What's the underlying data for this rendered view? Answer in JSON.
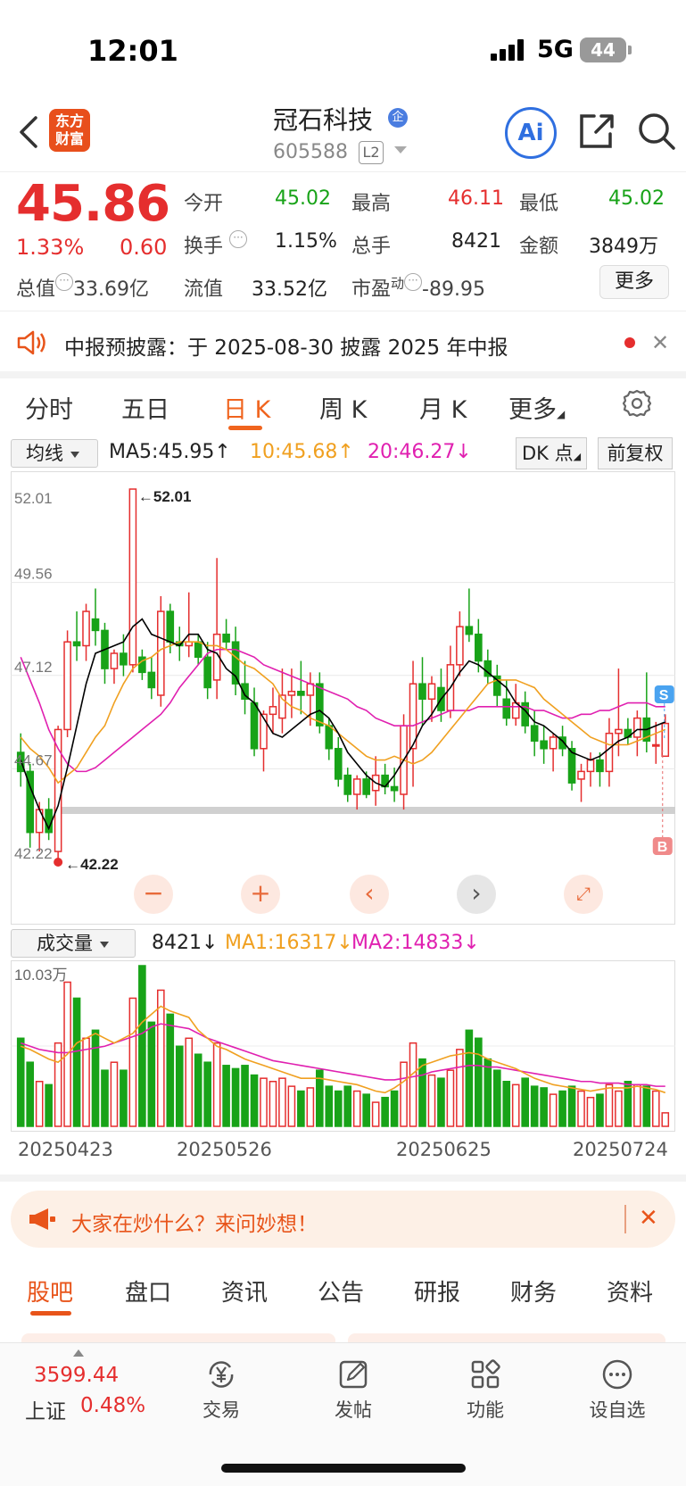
{
  "status": {
    "time": "12:01",
    "network": "5G",
    "battery": "44"
  },
  "header": {
    "logo_line1": "东方",
    "logo_line2": "财富",
    "stock_name": "冠石科技",
    "ent_badge": "企",
    "stock_code": "605588",
    "level": "L2",
    "ai_label": "Ai"
  },
  "quote": {
    "price": "45.86",
    "change_pct": "1.33%",
    "change": "0.60",
    "open_label": "今开",
    "open": "45.02",
    "high_label": "最高",
    "high": "46.11",
    "low_label": "最低",
    "low": "45.02",
    "turnover_label": "换手",
    "turnover": "1.15%",
    "volume_label": "总手",
    "volume": "8421",
    "amount_label": "金额",
    "amount": "3849万",
    "mcap_label": "总值",
    "mcap": "33.69亿",
    "float_label": "流值",
    "float": "33.52亿",
    "pe_label": "市盈",
    "pe_sup": "动",
    "pe": "-89.95",
    "more": "更多"
  },
  "notice": {
    "text": "中报预披露：于 2025-08-30 披露 2025 年中报"
  },
  "chart_tabs": [
    "分时",
    "五日",
    "日 K",
    "周 K",
    "月 K",
    "更多"
  ],
  "active_chart_tab": "日 K",
  "indicators": {
    "select": "均线",
    "ma5": "MA5:45.95↑",
    "ma10": "10:45.68↑",
    "ma20": "20:46.27↓",
    "dk": "DK 点",
    "fq": "前复权"
  },
  "volume_indicators": {
    "select": "成交量",
    "value": "8421↓",
    "ma1": "MA1:16317↓",
    "ma2": "MA2:14833↓"
  },
  "promo": {
    "text": "大家在炒什么？来问妙想！"
  },
  "bottom_tabs": [
    "股吧",
    "盘口",
    "资讯",
    "公告",
    "研报",
    "财务",
    "资料"
  ],
  "index": {
    "value": "3599.44",
    "name": "上证",
    "pct": "0.48%"
  },
  "nav": [
    "交易",
    "发帖",
    "功能",
    "设自选"
  ],
  "colors": {
    "up": "#e52e2e",
    "down": "#18a318",
    "ma5": "#000000",
    "ma10": "#f0a020",
    "ma20": "#e020b0",
    "accent": "#f0641e"
  },
  "chart_data": {
    "type": "candlestick",
    "y_ticks": [
      "52.01",
      "49.56",
      "47.12",
      "44.67",
      "42.22"
    ],
    "ylim": [
      42.22,
      52.01
    ],
    "max_label": "52.01",
    "min_label": "42.22",
    "x_ticks": [
      "20250423",
      "20250526",
      "20250625",
      "20250724"
    ],
    "volume_top_label": "10.03万",
    "volume_max": 100300,
    "markers": [
      "S",
      "B"
    ],
    "candles": [
      [
        45.1,
        45.6,
        44.2,
        44.6,
        55000
      ],
      [
        44.6,
        44.8,
        42.6,
        43.0,
        40000
      ],
      [
        43.0,
        43.8,
        42.5,
        43.6,
        28000
      ],
      [
        43.6,
        43.9,
        42.8,
        43.0,
        26000
      ],
      [
        42.5,
        45.8,
        42.22,
        45.7,
        52000
      ],
      [
        45.7,
        48.3,
        45.5,
        48.0,
        90000
      ],
      [
        48.0,
        48.8,
        47.5,
        47.9,
        80000
      ],
      [
        47.9,
        49.0,
        47.5,
        48.8,
        55000
      ],
      [
        48.6,
        49.4,
        47.9,
        48.3,
        60000
      ],
      [
        48.3,
        48.5,
        46.9,
        47.3,
        35000
      ],
      [
        47.3,
        47.8,
        46.9,
        47.7,
        40000
      ],
      [
        47.7,
        48.2,
        47.1,
        47.4,
        35000
      ],
      [
        47.4,
        52.01,
        47.2,
        52.01,
        80000
      ],
      [
        47.6,
        47.8,
        47.0,
        47.2,
        100300
      ],
      [
        47.2,
        47.6,
        46.5,
        46.8,
        65000
      ],
      [
        46.6,
        49.2,
        46.3,
        48.8,
        85000
      ],
      [
        48.8,
        49.0,
        47.7,
        48.0,
        70000
      ],
      [
        48.0,
        48.4,
        47.5,
        47.9,
        50000
      ],
      [
        47.9,
        49.3,
        47.6,
        48.0,
        55000
      ],
      [
        48.0,
        48.2,
        47.4,
        47.6,
        45000
      ],
      [
        47.6,
        48.0,
        46.5,
        46.8,
        40000
      ],
      [
        47.0,
        50.2,
        46.5,
        48.2,
        52000
      ],
      [
        48.2,
        48.6,
        47.8,
        48.0,
        38000
      ],
      [
        48.0,
        48.4,
        46.6,
        46.9,
        36000
      ],
      [
        46.9,
        47.5,
        46.1,
        46.5,
        38000
      ],
      [
        46.4,
        46.8,
        45.0,
        45.2,
        32000
      ],
      [
        45.2,
        46.2,
        44.6,
        46.1,
        30000
      ],
      [
        46.1,
        46.8,
        45.6,
        46.3,
        28000
      ],
      [
        46.0,
        47.3,
        45.6,
        46.6,
        30000
      ],
      [
        46.6,
        47.3,
        46.0,
        46.7,
        25000
      ],
      [
        46.7,
        47.5,
        46.1,
        46.6,
        22000
      ],
      [
        46.6,
        47.2,
        45.8,
        46.9,
        24000
      ],
      [
        46.9,
        47.2,
        45.6,
        45.8,
        35000
      ],
      [
        45.8,
        46.0,
        44.9,
        45.2,
        25000
      ],
      [
        45.2,
        45.5,
        44.2,
        44.4,
        22000
      ],
      [
        44.5,
        44.7,
        43.8,
        44.0,
        25000
      ],
      [
        44.0,
        44.5,
        43.6,
        44.4,
        22000
      ],
      [
        44.4,
        44.6,
        43.9,
        44.0,
        20000
      ],
      [
        44.1,
        45.0,
        43.7,
        44.5,
        15000
      ],
      [
        44.5,
        44.8,
        44.0,
        44.2,
        18000
      ],
      [
        44.2,
        44.7,
        43.8,
        44.1,
        22000
      ],
      [
        44.0,
        46.1,
        43.6,
        45.8,
        40000
      ],
      [
        45.2,
        47.5,
        44.2,
        46.9,
        52000
      ],
      [
        46.9,
        47.6,
        45.8,
        46.5,
        42000
      ],
      [
        46.5,
        47.1,
        45.9,
        46.9,
        32000
      ],
      [
        46.8,
        47.3,
        45.9,
        46.2,
        30000
      ],
      [
        46.2,
        47.9,
        46.0,
        47.4,
        35000
      ],
      [
        47.4,
        48.8,
        47.1,
        48.4,
        48000
      ],
      [
        48.4,
        49.4,
        48.0,
        48.2,
        60000
      ],
      [
        48.2,
        48.6,
        47.2,
        47.5,
        55000
      ],
      [
        47.5,
        47.8,
        46.9,
        47.1,
        42000
      ],
      [
        47.1,
        47.4,
        46.3,
        46.6,
        35000
      ],
      [
        46.5,
        47.0,
        45.8,
        46.0,
        28000
      ],
      [
        46.0,
        46.9,
        45.8,
        46.4,
        26000
      ],
      [
        46.4,
        46.7,
        45.6,
        45.8,
        30000
      ],
      [
        45.8,
        46.2,
        45.0,
        45.4,
        25000
      ],
      [
        45.4,
        45.8,
        44.8,
        45.2,
        24000
      ],
      [
        45.2,
        45.6,
        44.6,
        45.5,
        20000
      ],
      [
        45.5,
        45.8,
        45.0,
        45.2,
        22000
      ],
      [
        45.2,
        45.4,
        44.1,
        44.3,
        25000
      ],
      [
        44.4,
        44.8,
        43.8,
        44.6,
        22000
      ],
      [
        44.6,
        45.1,
        44.2,
        44.9,
        18000
      ],
      [
        44.9,
        45.1,
        44.2,
        44.6,
        20000
      ],
      [
        44.6,
        46.0,
        44.2,
        45.6,
        26000
      ],
      [
        45.6,
        47.3,
        45.0,
        45.7,
        22000
      ],
      [
        45.7,
        46.0,
        45.3,
        45.5,
        28000
      ],
      [
        45.5,
        46.2,
        45.0,
        46.0,
        26000
      ],
      [
        46.0,
        47.2,
        45.1,
        45.4,
        25000
      ],
      [
        45.3,
        45.9,
        44.8,
        45.3,
        22000
      ],
      [
        45.0,
        46.1,
        45.0,
        45.86,
        8421
      ]
    ],
    "ma5": [
      44.9,
      44.2,
      43.6,
      43.1,
      43.7,
      44.7,
      45.8,
      46.9,
      47.7,
      47.8,
      47.9,
      48.0,
      48.4,
      48.6,
      48.2,
      48.1,
      48.0,
      47.9,
      48.2,
      48.2,
      47.8,
      47.7,
      47.3,
      47.1,
      46.6,
      46.4,
      46.0,
      45.6,
      45.5,
      45.7,
      45.9,
      46.1,
      46.2,
      46.0,
      45.6,
      45.1,
      44.8,
      44.5,
      44.3,
      44.2,
      44.5,
      44.9,
      45.3,
      45.8,
      46.1,
      46.5,
      46.8,
      47.2,
      47.5,
      47.4,
      47.2,
      47.0,
      46.8,
      46.4,
      46.2,
      45.9,
      45.8,
      45.6,
      45.4,
      45.1,
      45.0,
      44.9,
      45.0,
      45.2,
      45.4,
      45.5,
      45.7,
      45.7,
      45.8,
      45.9
    ],
    "ma10": [
      45.5,
      45.2,
      45.0,
      44.7,
      44.3,
      44.5,
      44.7,
      45.1,
      45.5,
      45.8,
      46.4,
      46.9,
      47.3,
      47.5,
      47.6,
      47.8,
      47.9,
      48.0,
      48.0,
      48.0,
      47.9,
      47.9,
      47.8,
      47.6,
      47.4,
      47.3,
      47.1,
      46.9,
      46.5,
      46.3,
      46.2,
      46.0,
      45.9,
      45.8,
      45.6,
      45.4,
      45.2,
      45.0,
      44.9,
      44.9,
      45.0,
      44.9,
      44.8,
      44.9,
      45.1,
      45.4,
      45.7,
      46.0,
      46.3,
      46.6,
      46.9,
      47.0,
      47.0,
      47.0,
      46.9,
      46.8,
      46.5,
      46.3,
      46.1,
      45.9,
      45.7,
      45.5,
      45.4,
      45.3,
      45.3,
      45.3,
      45.4,
      45.5,
      45.6,
      45.7
    ],
    "ma20": [
      47.6,
      47.0,
      46.4,
      45.7,
      45.2,
      44.8,
      44.6,
      44.6,
      44.7,
      44.9,
      45.1,
      45.3,
      45.5,
      45.7,
      45.9,
      46.1,
      46.4,
      46.8,
      47.1,
      47.4,
      47.7,
      47.8,
      47.8,
      47.8,
      47.7,
      47.6,
      47.4,
      47.3,
      47.2,
      47.1,
      47.0,
      46.9,
      46.8,
      46.7,
      46.6,
      46.5,
      46.3,
      46.2,
      46.0,
      45.9,
      45.8,
      45.8,
      45.8,
      45.9,
      46.0,
      46.1,
      46.2,
      46.2,
      46.2,
      46.3,
      46.3,
      46.3,
      46.3,
      46.3,
      46.3,
      46.2,
      46.2,
      46.1,
      46.0,
      46.0,
      46.1,
      46.1,
      46.2,
      46.2,
      46.3,
      46.4,
      46.4,
      46.4,
      46.3,
      46.3
    ],
    "vol_ma1": [
      50000,
      48000,
      45000,
      42000,
      40000,
      45000,
      52000,
      55000,
      58000,
      55000,
      52000,
      55000,
      58000,
      65000,
      70000,
      75000,
      72000,
      70000,
      68000,
      60000,
      55000,
      50000,
      48000,
      45000,
      42000,
      40000,
      38000,
      36000,
      34000,
      32000,
      30000,
      30000,
      30000,
      29000,
      28000,
      27000,
      26000,
      24000,
      22000,
      21000,
      24000,
      28000,
      33000,
      38000,
      40000,
      42000,
      44000,
      45000,
      46000,
      45000,
      42000,
      40000,
      38000,
      36000,
      33000,
      30000,
      28000,
      26000,
      25000,
      24000,
      23000,
      22000,
      23000,
      24000,
      24000,
      24000,
      25000,
      24000,
      23000,
      21000
    ],
    "vol_ma2": [
      52000,
      50000,
      48000,
      47000,
      46000,
      46000,
      47000,
      48000,
      49000,
      50000,
      52000,
      54000,
      56000,
      58000,
      62000,
      64000,
      63000,
      62000,
      61000,
      58000,
      55000,
      53000,
      51000,
      49000,
      47000,
      45000,
      43000,
      41000,
      40000,
      39000,
      38000,
      37000,
      36000,
      35000,
      34000,
      33000,
      32000,
      31000,
      30000,
      29000,
      29000,
      30000,
      31000,
      32000,
      34000,
      35000,
      36000,
      37000,
      38000,
      38000,
      37000,
      37000,
      36000,
      35000,
      34000,
      33000,
      32000,
      31000,
      30000,
      29000,
      28000,
      28000,
      27000,
      27000,
      27000,
      26000,
      26000,
      26000,
      25000,
      25000
    ]
  }
}
